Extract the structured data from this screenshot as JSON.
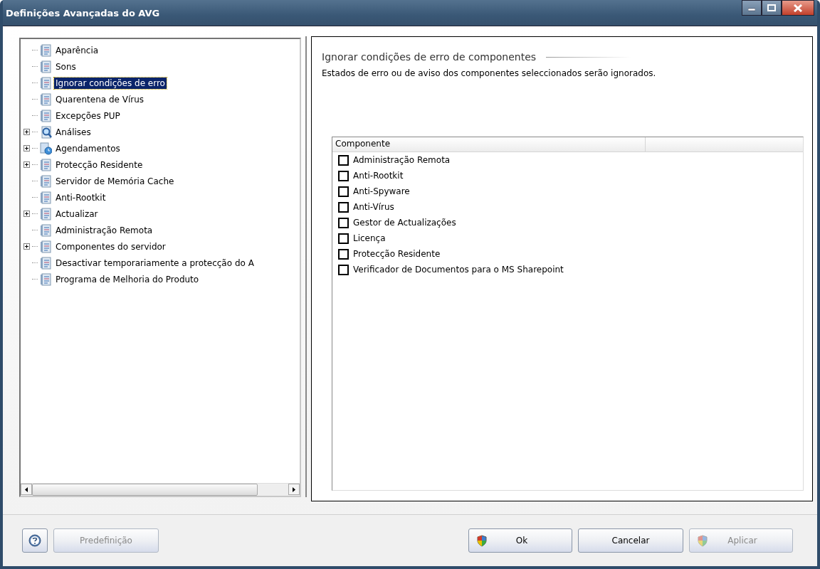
{
  "window": {
    "title": "Definições Avançadas do AVG"
  },
  "tree": [
    {
      "label": "Aparência",
      "kind": "page",
      "selected": false
    },
    {
      "label": "Sons",
      "kind": "page",
      "selected": false
    },
    {
      "label": "Ignorar condições de erro",
      "kind": "page",
      "selected": true
    },
    {
      "label": "Quarentena de Vírus",
      "kind": "page",
      "selected": false
    },
    {
      "label": "Excepções PUP",
      "kind": "page",
      "selected": false
    },
    {
      "label": "Análises",
      "kind": "scan",
      "expanded": false,
      "selected": false
    },
    {
      "label": "Agendamentos",
      "kind": "schedule",
      "expanded": false,
      "selected": false
    },
    {
      "label": "Protecção Residente",
      "kind": "group",
      "expanded": false,
      "selected": false
    },
    {
      "label": "Servidor de Memória Cache",
      "kind": "page",
      "selected": false
    },
    {
      "label": "Anti-Rootkit",
      "kind": "page",
      "selected": false
    },
    {
      "label": "Actualizar",
      "kind": "group",
      "expanded": false,
      "selected": false
    },
    {
      "label": "Administração Remota",
      "kind": "page",
      "selected": false
    },
    {
      "label": "Componentes do servidor",
      "kind": "group",
      "expanded": false,
      "selected": false
    },
    {
      "label": "Desactivar temporariamente a protecção do A",
      "kind": "page",
      "selected": false
    },
    {
      "label": "Programa de Melhoria do Produto",
      "kind": "page",
      "selected": false
    }
  ],
  "panel": {
    "heading": "Ignorar condições de erro de componentes",
    "description": "Estados de erro ou de aviso dos componentes seleccionados serão ignorados.",
    "table": {
      "columns": [
        "Componente"
      ],
      "rows": [
        {
          "label": "Administração Remota",
          "checked": false
        },
        {
          "label": "Anti-Rootkit",
          "checked": false
        },
        {
          "label": "Anti-Spyware",
          "checked": false
        },
        {
          "label": "Anti-Vírus",
          "checked": false
        },
        {
          "label": "Gestor de Actualizações",
          "checked": false
        },
        {
          "label": "Licença",
          "checked": false
        },
        {
          "label": "Protecção Residente",
          "checked": false
        },
        {
          "label": "Verificador de Documentos para o MS Sharepoint",
          "checked": false
        }
      ]
    }
  },
  "buttons": [
    {
      "kind": "help",
      "disabled": false
    },
    {
      "kind": "text",
      "label": "Predefinição",
      "disabled": true
    },
    {
      "kind": "shield",
      "label": "Ok",
      "disabled": false
    },
    {
      "kind": "text",
      "label": "Cancelar",
      "disabled": false
    },
    {
      "kind": "shield",
      "label": "Aplicar",
      "disabled": true
    }
  ]
}
